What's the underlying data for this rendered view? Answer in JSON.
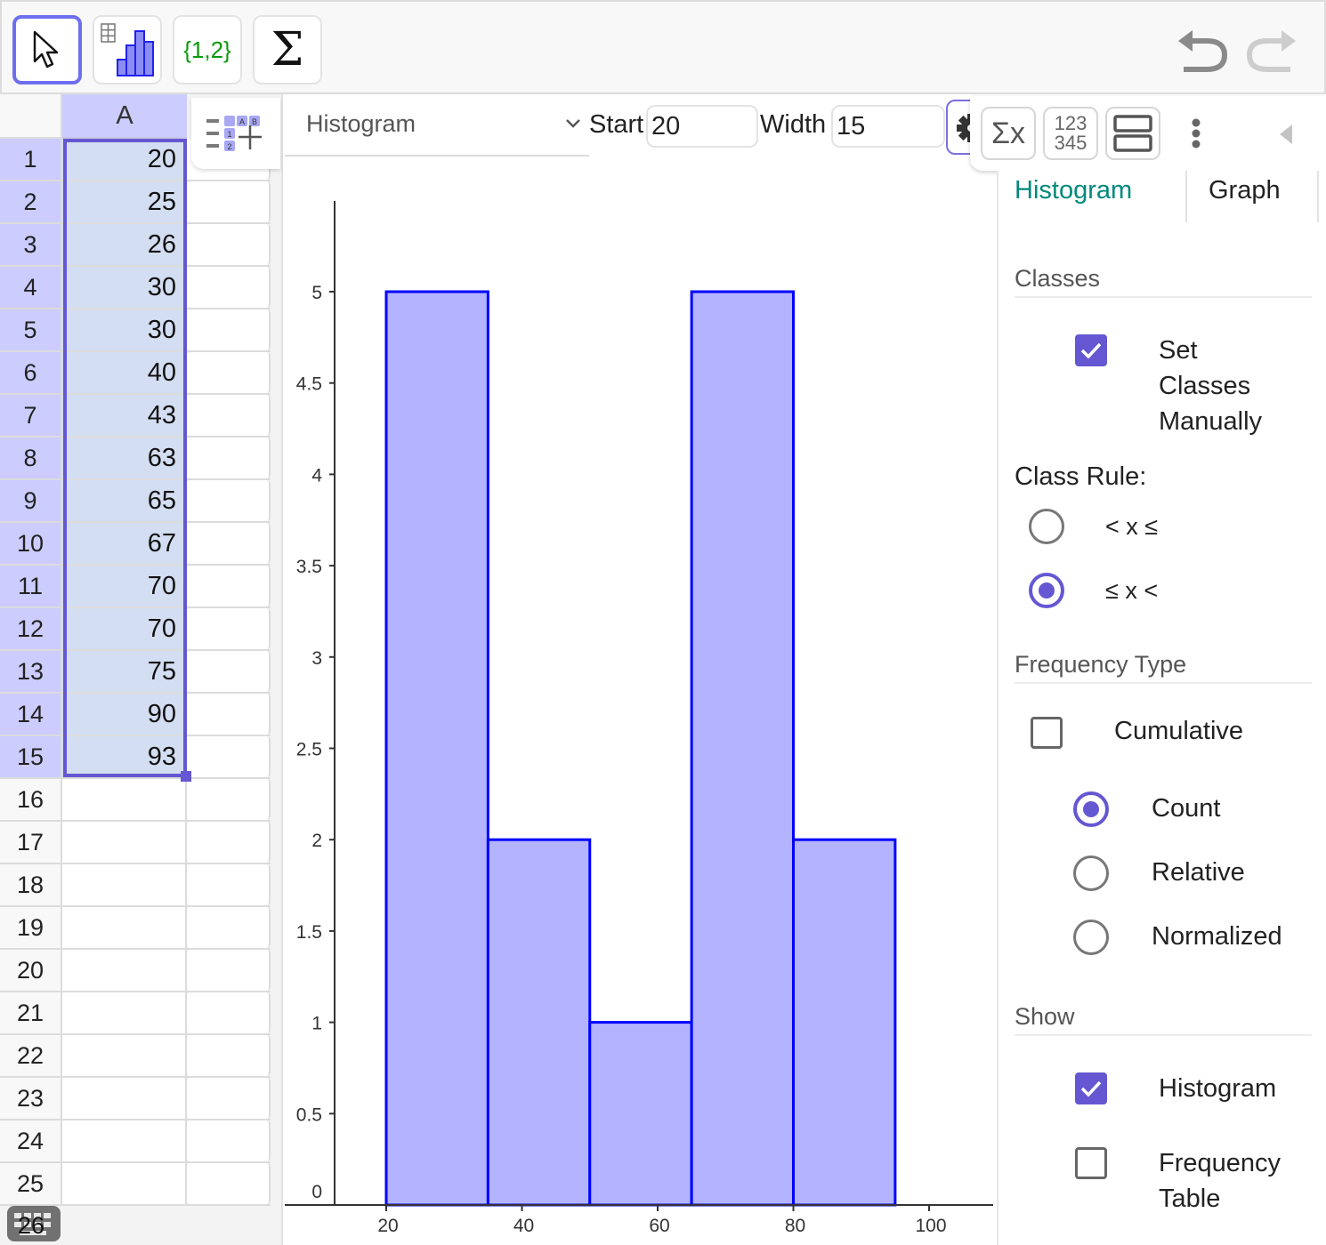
{
  "toolbar": {
    "tools": [
      {
        "name": "move-tool",
        "icon": "cursor-arrow-icon",
        "active": true
      },
      {
        "name": "one-variable-analysis-tool",
        "icon": "histogram-tool-icon",
        "active": false
      },
      {
        "name": "create-list-tool",
        "icon": "list-braces-icon",
        "label": "{1,2}",
        "active": false
      },
      {
        "name": "sum-tool",
        "icon": "sigma-icon",
        "label": "Σ",
        "active": false
      }
    ],
    "undo_icon": "undo-icon",
    "redo_icon": "redo-icon"
  },
  "spreadsheet": {
    "column_header": "A",
    "rows": [
      {
        "n": "1",
        "a": "20"
      },
      {
        "n": "2",
        "a": "25"
      },
      {
        "n": "3",
        "a": "26"
      },
      {
        "n": "4",
        "a": "30"
      },
      {
        "n": "5",
        "a": "30"
      },
      {
        "n": "6",
        "a": "40"
      },
      {
        "n": "7",
        "a": "43"
      },
      {
        "n": "8",
        "a": "63"
      },
      {
        "n": "9",
        "a": "65"
      },
      {
        "n": "10",
        "a": "67"
      },
      {
        "n": "11",
        "a": "70"
      },
      {
        "n": "12",
        "a": "70"
      },
      {
        "n": "13",
        "a": "75"
      },
      {
        "n": "14",
        "a": "90"
      },
      {
        "n": "15",
        "a": "93"
      },
      {
        "n": "16",
        "a": ""
      },
      {
        "n": "17",
        "a": ""
      },
      {
        "n": "18",
        "a": ""
      },
      {
        "n": "19",
        "a": ""
      },
      {
        "n": "20",
        "a": ""
      },
      {
        "n": "21",
        "a": ""
      },
      {
        "n": "22",
        "a": ""
      },
      {
        "n": "23",
        "a": ""
      },
      {
        "n": "24",
        "a": ""
      },
      {
        "n": "25",
        "a": ""
      }
    ],
    "last_row_number": "26",
    "selected_range": "A1:A15",
    "add_column_icon": "add-column-icon",
    "keyboard_icon": "keyboard-icon"
  },
  "chart_controls": {
    "chart_type": "Histogram",
    "start_label": "Start",
    "start_value": "20",
    "width_label": "Width",
    "width_value": "15",
    "settings_icon": "gear-icon"
  },
  "stylebar": {
    "buttons": [
      "statistics-sigma-x-icon",
      "data-table-123-icon",
      "layout-split-icon",
      "more-vert-icon",
      "collapse-left-icon"
    ],
    "stats_label": "Σx",
    "data_label_top": "123",
    "data_label_bottom": "345"
  },
  "settings": {
    "tabs": [
      {
        "label": "Histogram",
        "active": true
      },
      {
        "label": "Graph",
        "active": false
      }
    ],
    "classes": {
      "title": "Classes",
      "set_manually_label": "Set Classes Manually",
      "set_manually_lines": [
        "Set",
        "Classes",
        "Manually"
      ],
      "set_manually_checked": true,
      "class_rule_label": "Class Rule:",
      "rules": [
        {
          "label": "< x ≤",
          "selected": false
        },
        {
          "label": "≤ x <",
          "selected": true
        }
      ]
    },
    "frequency": {
      "title": "Frequency Type",
      "cumulative_label": "Cumulative",
      "cumulative_checked": false,
      "types": [
        {
          "label": "Count",
          "selected": true
        },
        {
          "label": "Relative",
          "selected": false
        },
        {
          "label": "Normalized",
          "selected": false
        }
      ]
    },
    "show": {
      "title": "Show",
      "histogram_label": "Histogram",
      "histogram_checked": true,
      "freq_table_lines": [
        "Frequency",
        "Table"
      ],
      "freq_table_label": "Frequency Table",
      "freq_table_checked": false
    }
  },
  "colors": {
    "accent": "#6557d2",
    "bar_fill": "#b3b3ff",
    "bar_stroke": "#0000ff",
    "tab_active": "#00897b",
    "selection_fill": "#d4def2",
    "header_highlight": "#ccccff"
  },
  "chart_data": {
    "type": "bar",
    "title": "",
    "xlabel": "",
    "ylabel": "",
    "bins": [
      {
        "start": 20,
        "end": 35,
        "value": 5
      },
      {
        "start": 35,
        "end": 50,
        "value": 2
      },
      {
        "start": 50,
        "end": 65,
        "value": 1
      },
      {
        "start": 65,
        "end": 80,
        "value": 5
      },
      {
        "start": 80,
        "end": 95,
        "value": 2
      }
    ],
    "categories": [
      "20–35",
      "35–50",
      "50–65",
      "65–80",
      "80–95"
    ],
    "values": [
      5,
      2,
      1,
      5,
      2
    ],
    "xlim": [
      12.5,
      110.5
    ],
    "ylim": [
      0,
      5.5
    ],
    "x_ticks": [
      20,
      40,
      60,
      80,
      100
    ],
    "x_tick_labels": [
      "20",
      "40",
      "60",
      "80",
      "100"
    ],
    "y_ticks": [
      0,
      0.5,
      1,
      1.5,
      2,
      2.5,
      3,
      3.5,
      4,
      4.5,
      5
    ],
    "y_tick_labels": [
      "0",
      "0.5",
      "1",
      "1.5",
      "2",
      "2.5",
      "3",
      "3.5",
      "4",
      "4.5",
      "5"
    ],
    "grid": false,
    "legend": "none"
  }
}
